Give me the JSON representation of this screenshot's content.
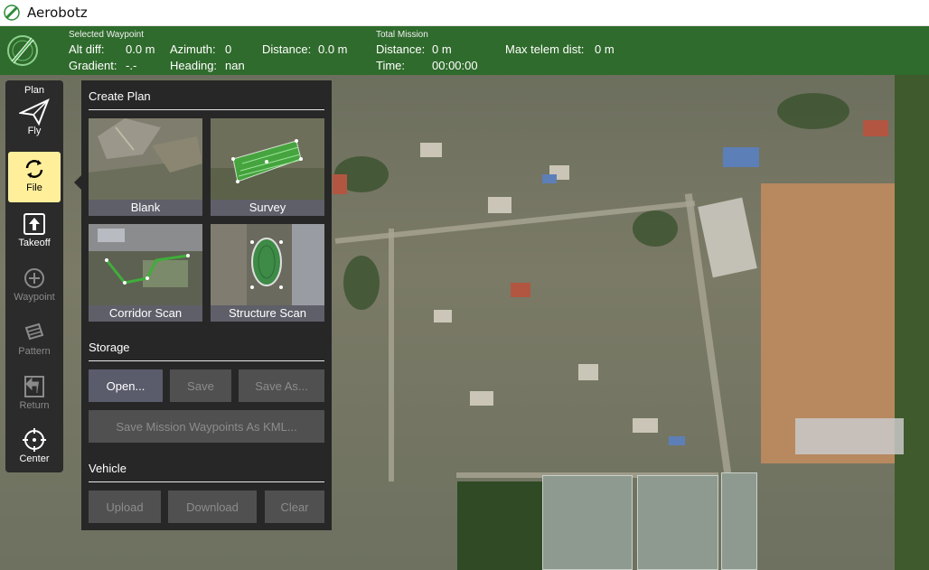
{
  "window": {
    "title": "Aerobotz"
  },
  "status": {
    "selected_waypoint_label": "Selected Waypoint",
    "alt_diff_label": "Alt diff:",
    "alt_diff_value": "0.0 m",
    "azimuth_label": "Azimuth:",
    "azimuth_value": "0",
    "distance_label": "Distance:",
    "distance_value": "0.0 m",
    "gradient_label": "Gradient:",
    "gradient_value": "-.-",
    "heading_label": "Heading:",
    "heading_value": "nan",
    "total_mission_label": "Total Mission",
    "mission_distance_label": "Distance:",
    "mission_distance_value": "0 m",
    "max_telem_label": "Max telem dist:",
    "max_telem_value": "0 m",
    "time_label": "Time:",
    "time_value": "00:00:00"
  },
  "toolstrip": {
    "plan_label": "Plan",
    "items": [
      {
        "label": "Fly",
        "icon": "paper-plane-icon",
        "state": "enabled"
      },
      {
        "label": "File",
        "icon": "sync-icon",
        "state": "active"
      },
      {
        "label": "Takeoff",
        "icon": "takeoff-icon",
        "state": "enabled"
      },
      {
        "label": "Waypoint",
        "icon": "plus-circle-icon",
        "state": "disabled"
      },
      {
        "label": "Pattern",
        "icon": "pattern-icon",
        "state": "disabled"
      },
      {
        "label": "Return",
        "icon": "return-icon",
        "state": "disabled"
      },
      {
        "label": "Center",
        "icon": "crosshair-icon",
        "state": "enabled"
      }
    ]
  },
  "panel": {
    "create_plan_title": "Create Plan",
    "tiles": [
      {
        "label": "Blank"
      },
      {
        "label": "Survey"
      },
      {
        "label": "Corridor Scan"
      },
      {
        "label": "Structure Scan"
      }
    ],
    "storage_title": "Storage",
    "open_label": "Open...",
    "save_label": "Save",
    "save_as_label": "Save As...",
    "save_kml_label": "Save Mission Waypoints As KML...",
    "vehicle_title": "Vehicle",
    "upload_label": "Upload",
    "download_label": "Download",
    "clear_label": "Clear"
  },
  "colors": {
    "statusbar": "#2f6b2c",
    "panel": "#272727",
    "active_tool": "#ffef9b",
    "button_enabled": "#5a5c6c",
    "button_disabled": "#505050"
  }
}
